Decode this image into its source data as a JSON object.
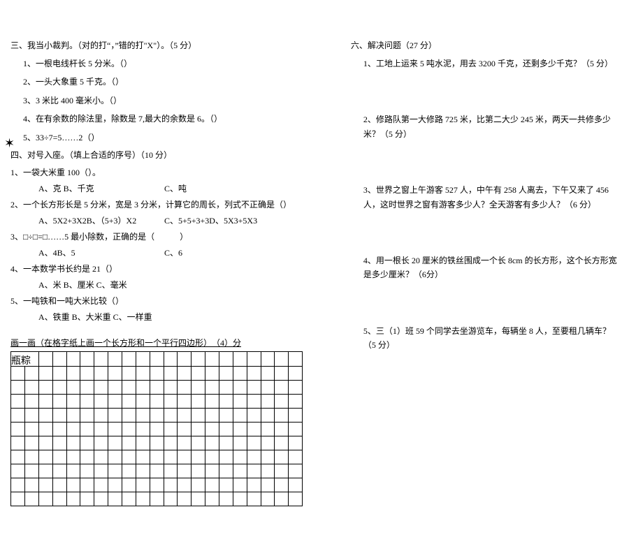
{
  "left": {
    "section3": {
      "title": "三、我当小裁判。（对的打“，”错的打\"X\"）。（5 分）",
      "items": [
        "1、一根电线杆长 5 分米。（）",
        "2、一头大象重 5 千克。（）",
        "3、3 米比 400 毫米小。（）",
        "4、在有余数的除法里，除数是 7,最大的余数是 6。（）",
        "5、33÷7=5……2（）"
      ]
    },
    "star": "✶",
    "section4": {
      "title": "四、对号入座。（填上合适的序号）（10 分）",
      "q1": {
        "text": "1、一袋大米重 100（）。",
        "opts": [
          "A、克 B、千克",
          "C、吨"
        ]
      },
      "q2": {
        "text": "2、一个长方形长是 5 分米，宽是 3 分米，计算它的周长，列式不正确是（）",
        "opts": [
          "A、5X2+3X2B、（5+3）X2",
          "C、5+5+3+3D、5X3+5X3"
        ]
      },
      "q3": {
        "text": "3、□÷□=□……5 最小除数，正确的是（　　　）",
        "opts": [
          "A、4B、5",
          "C、6"
        ]
      },
      "q4": {
        "text": "4、一本数学书长约是 21（）",
        "opts": [
          "A、米 B、厘米 C、毫米"
        ]
      },
      "q5": {
        "text": "5、一吨铁和一吨大米比较（）",
        "opts": [
          "A、铁重 B、大米重 C、一样重"
        ]
      }
    },
    "section5": {
      "caption": "画一画（在格字纸上画一个长方形和一个平行四边形）　（4）分",
      "gridlabel": "瓶粽"
    }
  },
  "right": {
    "section6": {
      "title": "六、解决问题（27 分）",
      "q1": "1、工地上运来 5 吨水泥，用去 3200 千克，还剩多少千克？（5 分）",
      "q2": "2、修路队第一大修路 725 米，比第二大少 245 米，两天一共修多少米？（5 分）",
      "q3": "3、世界之窗上午游客 527 人，中午有 258 人离去，下午又来了 456 人，这时世界之窗有游客多少人？全天游客有多少人？（6 分）",
      "q4": "4、用一根长 20 厘米的铁丝围成一个长 8cm 的长方形，这个长方形宽是多少厘米？（6分）",
      "q5": "5、三（1）班 59 个同学去坐游览车，每辆坐 8 人，至要租几辆车？（5 分）"
    }
  }
}
